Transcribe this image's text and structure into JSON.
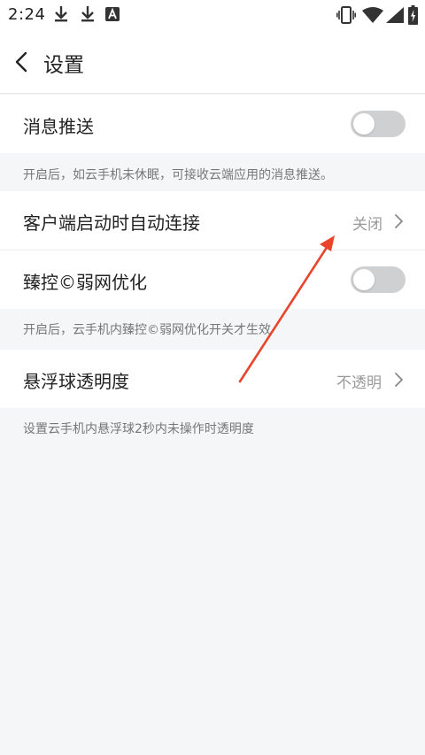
{
  "status_bar": {
    "time": "2:24",
    "icons": [
      "download-icon",
      "download-icon",
      "a-badge-icon",
      "vibrate-icon",
      "wifi-icon",
      "signal-icon",
      "battery-charging-icon"
    ]
  },
  "app_bar": {
    "title": "设置",
    "back_icon": "chevron-left-icon"
  },
  "settings": {
    "push": {
      "label": "消息推送",
      "toggle_on": false,
      "note": "开启后，如云手机未休眠，可接收云端应用的消息推送。"
    },
    "auto_connect": {
      "label": "客户端启动时自动连接",
      "value": "关闭"
    },
    "weak_net": {
      "label": "臻控©弱网优化",
      "toggle_on": false,
      "note": "开启后，云手机内臻控©弱网优化开关才生效"
    },
    "float_ball": {
      "label": "悬浮球透明度",
      "value": "不透明",
      "note": "设置云手机内悬浮球2秒内未操作时透明度"
    }
  },
  "colors": {
    "annotation_arrow": "#e8452c",
    "toggle_off": "#cfd0d2",
    "background": "#f5f6f8"
  }
}
